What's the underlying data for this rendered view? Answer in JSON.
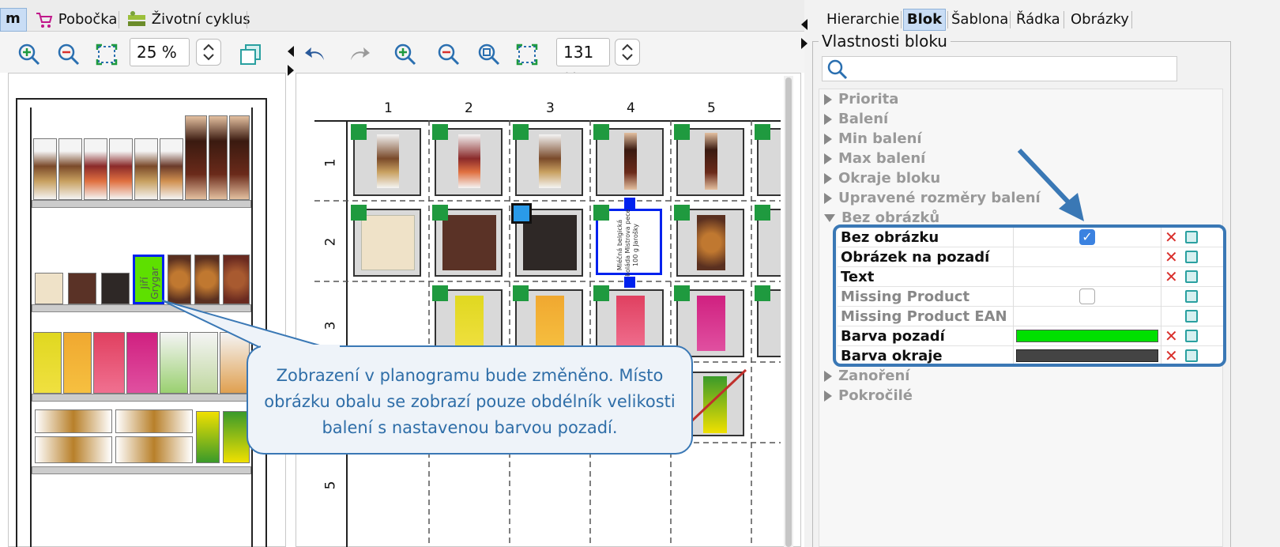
{
  "top_tabs": [
    "m",
    "Pobočka",
    "Životní cyklus"
  ],
  "left_zoom": "25 %",
  "center_zoom": "131 %",
  "right_tabs": [
    "Hierarchie",
    "Blok",
    "Šablona",
    "Řádka",
    "Obrázky"
  ],
  "properties_title": "Vlastnosti bloku",
  "search_placeholder": "",
  "collapsed_groups": [
    "Priorita",
    "Balení",
    "Min balení",
    "Max balení",
    "Okraje bloku",
    "Upravené rozměry balení"
  ],
  "expanded_group": "Bez obrázků",
  "properties": [
    {
      "label": "Bez obrázku",
      "value": "checked"
    },
    {
      "label": "Obrázek na pozadí",
      "value": ""
    },
    {
      "label": "Text",
      "value": ""
    },
    {
      "label": "Missing Product",
      "value": "unchecked"
    },
    {
      "label": "Missing Product EAN",
      "value": ""
    },
    {
      "label": "Barva pozadí",
      "value": "#00e000"
    },
    {
      "label": "Barva okraje",
      "value": "#444444"
    }
  ],
  "trailing_groups": [
    "Zanoření",
    "Pokročilé"
  ],
  "grid_columns": [
    "1",
    "2",
    "3",
    "4",
    "5"
  ],
  "grid_rows": [
    "1",
    "2",
    "3",
    "5"
  ],
  "highlighted_product_text": "Jiří Grygar",
  "cell_text": "Mléčná belgická čokoláda Mistrova pecet 100 g Jarošky",
  "callout_text": "Zobrazení v planogramu bude změněno. Místo obrázku obalu se zobrazí pouze obdélník velikosti balení s nastavenou barvou pozadí.",
  "colors": {
    "accent": "#3a78b5",
    "green": "#1f9a3f",
    "blue": "#0022ee",
    "selected_tab": "#c9ddf5"
  }
}
